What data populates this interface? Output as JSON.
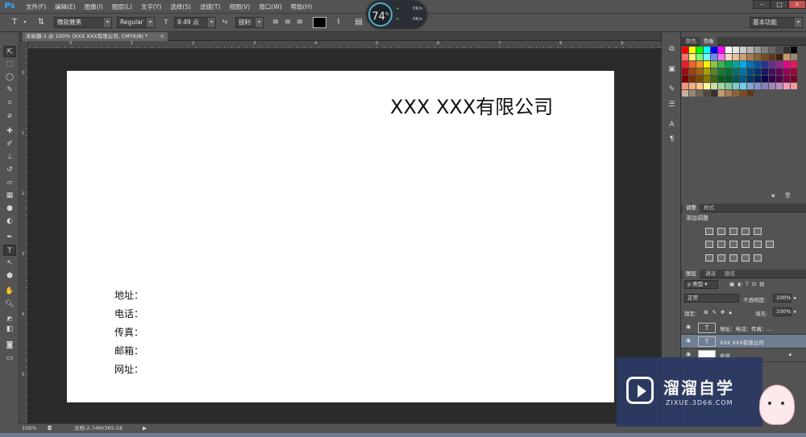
{
  "app": {
    "logo": "Ps",
    "menu": [
      "文件(F)",
      "编辑(E)",
      "图像(I)",
      "图层(L)",
      "文字(Y)",
      "选择(S)",
      "滤镜(T)",
      "视图(V)",
      "窗口(W)",
      "帮助(H)"
    ],
    "window_controls": [
      "–",
      "□",
      "×"
    ]
  },
  "options_bar": {
    "tool_icon": "T",
    "font_family": "微软雅黑",
    "font_style": "Regular",
    "font_size": "9.49 点",
    "antialias": "锐利",
    "workspace": "基本功能"
  },
  "perf_gauge": {
    "percent": "74",
    "unit": "%",
    "up_rate": "0K/s",
    "down_rate": "0K/s"
  },
  "document": {
    "tab_title": "未标题-1 @ 100% (XXX XXX有限公司, CMYK/8) *",
    "tab_close": "×",
    "company_name": "XXX XXX有限公司",
    "contact_lines": [
      "地址：",
      "电话：",
      "传真：",
      "邮箱：",
      "网址："
    ]
  },
  "rulers": {
    "top_ticks": [
      "0",
      "1",
      "2",
      "3",
      "4",
      "5",
      "6",
      "7",
      "8",
      "9"
    ],
    "left_ticks": [
      "0",
      "1",
      "2",
      "3",
      "4",
      "5"
    ]
  },
  "status": {
    "zoom": "100%",
    "doc_info": "文档:2.74M/365.5K"
  },
  "panels": {
    "color_tabs": [
      "颜色",
      "色板"
    ],
    "adjust_tabs": [
      "调整",
      "样式"
    ],
    "adjust_title": "添加调整",
    "layers_tabs": [
      "图层",
      "通道",
      "路径"
    ],
    "filter_kind": "类型",
    "blend_mode": "正常",
    "opacity_label": "不透明度:",
    "opacity_value": "100%",
    "lock_label": "锁定:",
    "fill_label": "填充:",
    "fill_value": "100%",
    "layers": [
      {
        "name": "地址：电话：传真：...",
        "thumb": "T",
        "selected": false
      },
      {
        "name": "XXX XXX有限公司",
        "thumb": "T",
        "selected": true
      },
      {
        "name": "背景",
        "thumb": "",
        "selected": false
      }
    ]
  },
  "watermark": {
    "cn": "溜溜自学",
    "en": "ZIXUE.3D66.COM"
  },
  "swatch_colors": [
    "#ff0000",
    "#ffff00",
    "#00ff00",
    "#00ffff",
    "#0000ff",
    "#ff00ff",
    "#ffffff",
    "#e6e6e6",
    "#cccccc",
    "#b3b3b3",
    "#999999",
    "#808080",
    "#666666",
    "#4d4d4d",
    "#333333",
    "#000000",
    "#ff6f6f",
    "#fff56f",
    "#6fff75",
    "#6ff7ff",
    "#6f8bff",
    "#ff6ff1",
    "#f7d9c4",
    "#e5c19c",
    "#c9a073",
    "#a67c52",
    "#8c6239",
    "#754c24",
    "#603813",
    "#3c2415",
    "#c69c6d",
    "#998675",
    "#ed1c24",
    "#f26522",
    "#f7941d",
    "#fff200",
    "#8dc63f",
    "#39b54a",
    "#00a651",
    "#00a99d",
    "#00aeef",
    "#0072bc",
    "#0054a6",
    "#2e3192",
    "#662d91",
    "#92278f",
    "#ec008c",
    "#ed145b",
    "#9e0b0f",
    "#a0410d",
    "#a3620a",
    "#aba000",
    "#598527",
    "#197b30",
    "#007236",
    "#00746b",
    "#0076a3",
    "#004a80",
    "#003471",
    "#1b1464",
    "#440e62",
    "#630460",
    "#9e005d",
    "#9e0039",
    "#790000",
    "#7b2e00",
    "#7d4900",
    "#827b00",
    "#406618",
    "#005e20",
    "#005826",
    "#005952",
    "#005b7f",
    "#003663",
    "#002157",
    "#0d004c",
    "#32004b",
    "#4b0049",
    "#7b0046",
    "#7a0026",
    "#f69679",
    "#f9ad81",
    "#fdc68a",
    "#fff79a",
    "#c4df9b",
    "#a3d39c",
    "#82ca9d",
    "#7accc8",
    "#6dcff6",
    "#7da7d9",
    "#8393ca",
    "#8781bd",
    "#a186be",
    "#bd8cbf",
    "#f49ac1",
    "#f5989d",
    "#c7b299",
    "#998675",
    "#736357",
    "#534741",
    "#37302d",
    "#c69c6d",
    "#a67c52",
    "#8c6239",
    "#754c24",
    "#603813"
  ]
}
